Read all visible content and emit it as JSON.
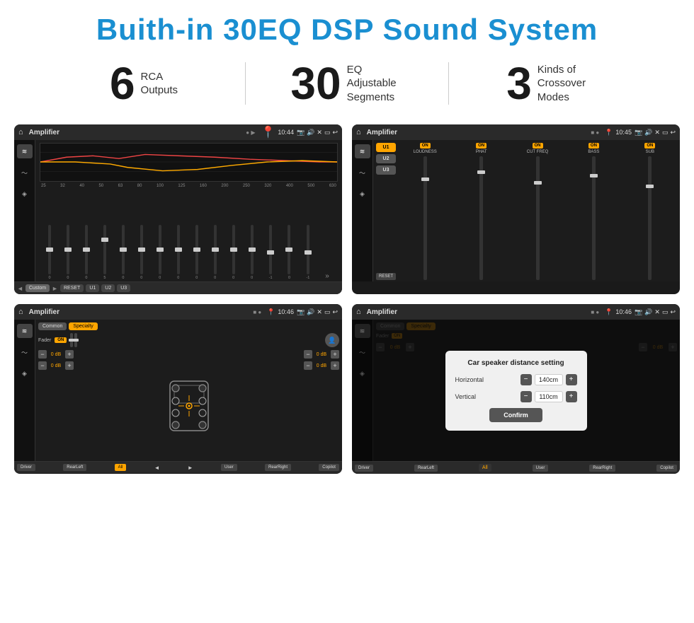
{
  "header": {
    "title": "Buith-in 30EQ DSP Sound System"
  },
  "stats": [
    {
      "number": "6",
      "text": "RCA\nOutputs"
    },
    {
      "number": "30",
      "text": "EQ Adjustable\nSegments"
    },
    {
      "number": "3",
      "text": "Kinds of\nCrossover Modes"
    }
  ],
  "screens": [
    {
      "id": "screen1",
      "title": "Amplifier",
      "time": "10:44",
      "type": "eq",
      "eq_freqs": [
        "25",
        "32",
        "40",
        "50",
        "63",
        "80",
        "100",
        "125",
        "160",
        "200",
        "250",
        "320",
        "400",
        "500",
        "630"
      ],
      "eq_vals": [
        "0",
        "0",
        "0",
        "5",
        "0",
        "0",
        "0",
        "0",
        "0",
        "0",
        "0",
        "0",
        "-1",
        "0",
        "-1"
      ],
      "eq_preset": "Custom",
      "buttons": [
        "◄",
        "Custom",
        "►",
        "RESET",
        "U1",
        "U2",
        "U3"
      ]
    },
    {
      "id": "screen2",
      "title": "Amplifier",
      "time": "10:45",
      "type": "channels",
      "presets": [
        "U1",
        "U2",
        "U3"
      ],
      "channels": [
        {
          "label": "LOUDNESS",
          "on": true
        },
        {
          "label": "PHAT",
          "on": true
        },
        {
          "label": "CUT FREQ",
          "on": true
        },
        {
          "label": "BASS",
          "on": true
        },
        {
          "label": "SUB",
          "on": true
        }
      ]
    },
    {
      "id": "screen3",
      "title": "Amplifier",
      "time": "10:46",
      "type": "fader",
      "tabs": [
        "Common",
        "Specialty"
      ],
      "active_tab": "Specialty",
      "fader_label": "Fader",
      "fader_on": "ON",
      "vol_values": [
        "0 dB",
        "0 dB",
        "0 dB",
        "0 dB"
      ],
      "bottom_buttons": [
        "Driver",
        "RearLeft",
        "All",
        "User",
        "RearRight",
        "Copilot"
      ]
    },
    {
      "id": "screen4",
      "title": "Amplifier",
      "time": "10:46",
      "type": "dialog",
      "tabs": [
        "Common",
        "Specialty"
      ],
      "dialog": {
        "title": "Car speaker distance setting",
        "horizontal_label": "Horizontal",
        "horizontal_value": "140cm",
        "vertical_label": "Vertical",
        "vertical_value": "110cm",
        "confirm_label": "Confirm"
      },
      "bottom_buttons": [
        "Driver",
        "RearLeft",
        "All",
        "User",
        "RearRight",
        "Copilot"
      ]
    }
  ]
}
